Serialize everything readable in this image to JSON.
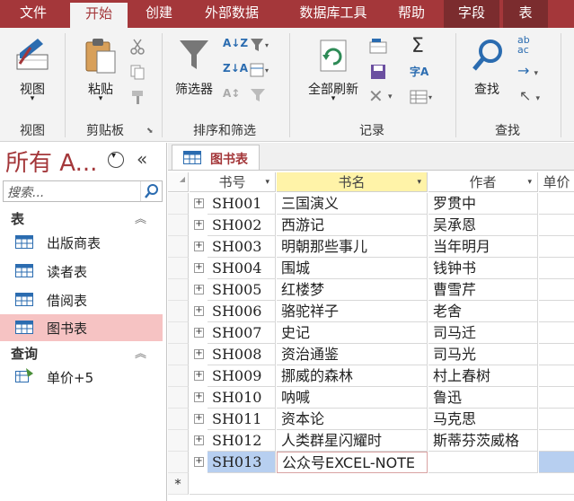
{
  "ribbon_tabs": [
    "文件",
    "开始",
    "创建",
    "外部数据",
    "数据库工具",
    "帮助",
    "字段",
    "表"
  ],
  "active_tab": "开始",
  "groups": {
    "views": {
      "label": "视图",
      "view_button": "视图"
    },
    "clipboard": {
      "label": "剪贴板",
      "paste_button": "粘贴"
    },
    "sort_filter": {
      "label": "排序和筛选",
      "filter_button": "筛选器"
    },
    "records": {
      "label": "记录",
      "refresh_button": "全部刷新"
    },
    "find": {
      "label": "查找",
      "find_button": "查找"
    }
  },
  "nav": {
    "title": "所有 A...",
    "search_placeholder": "搜索...",
    "sections": [
      {
        "title": "表",
        "items": [
          "出版商表",
          "读者表",
          "借阅表",
          "图书表"
        ]
      },
      {
        "title": "查询",
        "items": [
          "单价+5"
        ]
      }
    ],
    "selected_item": "图书表"
  },
  "document_tab": "图书表",
  "datasheet": {
    "columns": [
      "书号",
      "书名",
      "作者",
      "单价"
    ],
    "sorted_column": "书名",
    "rows": [
      [
        "SH001",
        "三国演义",
        "罗贯中"
      ],
      [
        "SH002",
        "西游记",
        "吴承恩"
      ],
      [
        "SH003",
        "明朝那些事儿",
        "当年明月"
      ],
      [
        "SH004",
        "围城",
        "钱钟书"
      ],
      [
        "SH005",
        "红楼梦",
        "曹雪芹"
      ],
      [
        "SH006",
        "骆驼祥子",
        "老舍"
      ],
      [
        "SH007",
        "史记",
        "司马迁"
      ],
      [
        "SH008",
        "资治通鉴",
        "司马光"
      ],
      [
        "SH009",
        "挪威的森林",
        "村上春树"
      ],
      [
        "SH010",
        "呐喊",
        "鲁迅"
      ],
      [
        "SH011",
        "资本论",
        "马克思"
      ],
      [
        "SH012",
        "人类群星闪耀时",
        "斯蒂芬茨威格"
      ],
      [
        "SH013",
        "公众号EXCEL-NOTE",
        ""
      ]
    ],
    "current_row": 12,
    "new_row_marker": "*"
  },
  "colors": {
    "accent": "#a4373a",
    "selection": "#b7cff0",
    "nav_selected": "#f6c3c3",
    "sorted_header": "#fff3a8"
  }
}
